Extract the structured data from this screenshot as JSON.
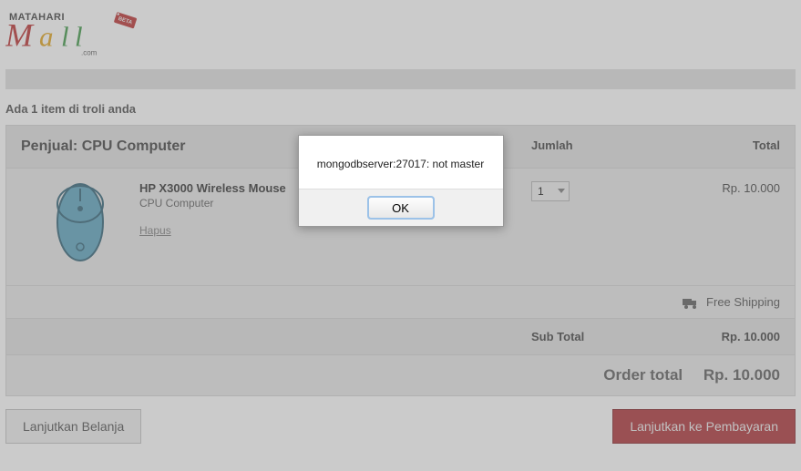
{
  "cart_header": "Ada 1 item di troli anda",
  "seller": {
    "label_prefix": "Penjual: ",
    "name": "CPU Computer"
  },
  "columns": {
    "qty": "Jumlah",
    "total": "Total"
  },
  "item": {
    "name": "HP X3000 Wireless Mouse",
    "seller": "CPU Computer",
    "remove_label": "Hapus",
    "qty_value": "1",
    "price": "Rp. 10.000"
  },
  "shipping": {
    "label": "Free Shipping"
  },
  "subtotal": {
    "label": "Sub Total",
    "value": "Rp. 10.000"
  },
  "order_total": {
    "label": "Order total",
    "value": "Rp. 10.000"
  },
  "actions": {
    "continue_shopping": "Lanjutkan Belanja",
    "proceed_payment": "Lanjutkan ke Pembayaran"
  },
  "modal": {
    "message": "mongodbserver:27017: not master",
    "ok": "OK"
  }
}
